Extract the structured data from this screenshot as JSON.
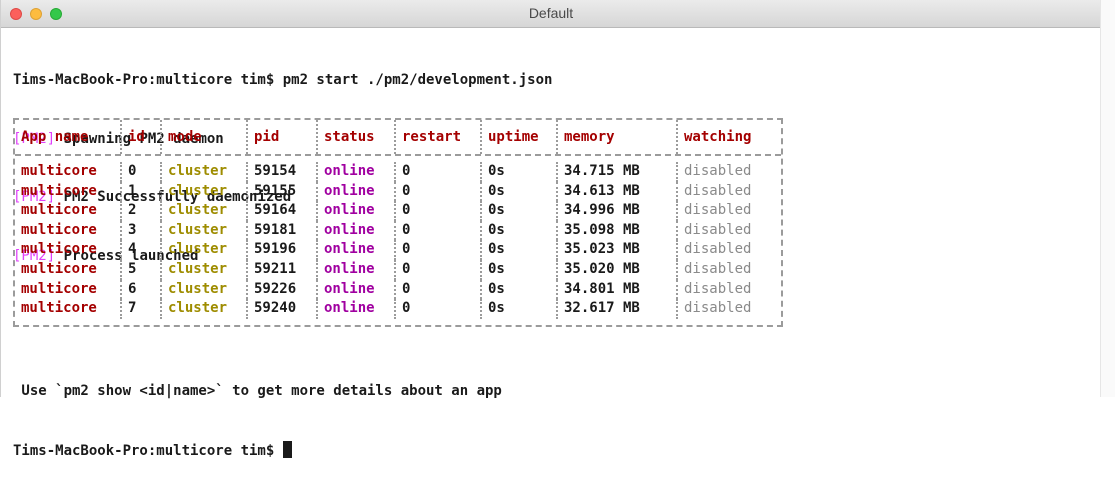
{
  "window": {
    "title": "Default"
  },
  "terminal": {
    "command_line": "Tims-MacBook-Pro:multicore tim$ pm2 start ./pm2/development.json",
    "logs": [
      {
        "tag": "[PM2]",
        "text": " Spawning PM2 daemon"
      },
      {
        "tag": "[PM2]",
        "text": " PM2 Successfully daemonized"
      },
      {
        "tag": "[PM2]",
        "text": " Process launched"
      }
    ],
    "table": {
      "headers": [
        "App name",
        "id",
        "mode",
        "pid",
        "status",
        "restart",
        "uptime",
        "memory",
        "watching"
      ],
      "rows": [
        [
          "multicore",
          "0",
          "cluster",
          "59154",
          "online",
          "0",
          "0s",
          "34.715 MB",
          "disabled"
        ],
        [
          "multicore",
          "1",
          "cluster",
          "59155",
          "online",
          "0",
          "0s",
          "34.613 MB",
          "disabled"
        ],
        [
          "multicore",
          "2",
          "cluster",
          "59164",
          "online",
          "0",
          "0s",
          "34.996 MB",
          "disabled"
        ],
        [
          "multicore",
          "3",
          "cluster",
          "59181",
          "online",
          "0",
          "0s",
          "35.098 MB",
          "disabled"
        ],
        [
          "multicore",
          "4",
          "cluster",
          "59196",
          "online",
          "0",
          "0s",
          "35.023 MB",
          "disabled"
        ],
        [
          "multicore",
          "5",
          "cluster",
          "59211",
          "online",
          "0",
          "0s",
          "35.020 MB",
          "disabled"
        ],
        [
          "multicore",
          "6",
          "cluster",
          "59226",
          "online",
          "0",
          "0s",
          "34.801 MB",
          "disabled"
        ],
        [
          "multicore",
          "7",
          "cluster",
          "59240",
          "online",
          "0",
          "0s",
          "32.617 MB",
          "disabled"
        ]
      ]
    },
    "hint": " Use `pm2 show <id|name>` to get more details about an app",
    "prompt": "Tims-MacBook-Pro:multicore tim$ "
  },
  "colors": {
    "pm2_tag": "#e040fb",
    "app_name": "#a40000",
    "mode": "#9e8c00",
    "status": "#a000a0",
    "watching": "#8a8a8a"
  }
}
